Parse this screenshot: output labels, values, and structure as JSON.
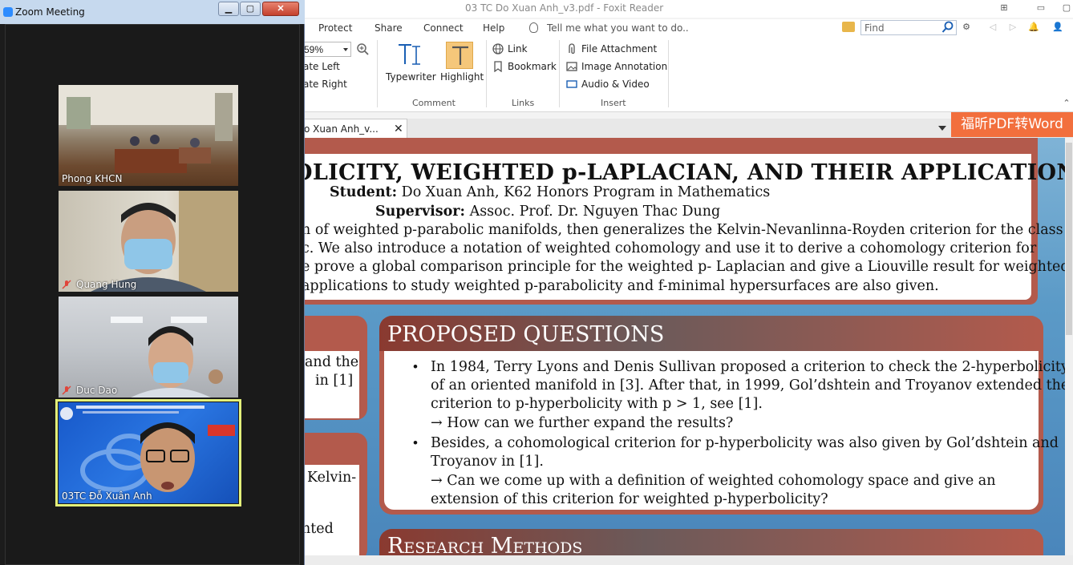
{
  "foxit": {
    "title": "03 TC Do Xuan Anh_v3.pdf - Foxit Reader",
    "menu": [
      "Protect",
      "Share",
      "Connect",
      "Help"
    ],
    "tellme_placeholder": "Tell me what you want to do..",
    "find_placeholder": "Find",
    "ribbon": {
      "zoom_value": "59%",
      "rotate_left": "ate Left",
      "rotate_right": "ate Right",
      "typewriter": "Typewriter",
      "highlight": "Highlight",
      "comment_group": "Comment",
      "link": "Link",
      "bookmark": "Bookmark",
      "links_group": "Links",
      "file_attachment": "File Attachment",
      "image_annotation": "Image Annotation",
      "audio_video": "Audio & Video",
      "insert_group": "Insert"
    },
    "tab_label": "o Xuan Anh_v...",
    "convert_button": "福昕PDF转Word"
  },
  "poster": {
    "title": "OLICITY, WEIGHTED p-LAPLACIAN, AND THEIR APPLICATIONS",
    "student_label": "Student:",
    "student_value": "Do Xuan Anh, K62 Honors Program in Mathematics",
    "supervisor_label": "Supervisor:",
    "supervisor_value": "Assoc. Prof. Dr. Nguyen Thac Dung",
    "abstract_lines": [
      "n of weighted p-parabolic manifolds, then generalizes the Kelvin-Nevanlinna-Royden criterion for the class",
      "c. We also introduce a notation of weighted cohomology and use it to derive a cohomology criterion for",
      "e prove a global comparison principle for the weighted p- Laplacian and give a Liouville result for weighted",
      "applications to study weighted p-parabolicity and f-minimal hypersurfaces are also given."
    ],
    "left_card_1_lines": [
      "and  the",
      "in   [1]"
    ],
    "left_card_2_lines": [
      "Kelvin-",
      "hted"
    ],
    "pq_title": "PROPOSED QUESTIONS",
    "pq_lines": [
      "In 1984, Terry Lyons and Denis Sullivan proposed a criterion to check the 2-hyperbolicity",
      "of an oriented manifold in [3]. After that, in 1999, Gol’dshtein and Troyanov extended the",
      "criterion to p-hyperbolicity with p > 1, see [1].",
      "→ How can we further expand the results?",
      "Besides, a cohomological criterion for p-hyperbolicity was also given by Gol’dshtein and",
      "Troyanov in [1].",
      "→ Can we come up with a definition of weighted cohomology space and give an",
      "extension of this criterion for weighted p-hyperbolicity?"
    ],
    "rm_title": "Research Methods"
  },
  "zoom": {
    "title": "Zoom Meeting",
    "participants": [
      {
        "name": "Phong KHCN",
        "muted": false
      },
      {
        "name": "Quang Hung",
        "muted": true
      },
      {
        "name": "Duc Dao",
        "muted": true
      },
      {
        "name": "03TC Đỗ Xuân Anh",
        "muted": false
      }
    ],
    "active_speaker_color": "#e3f07a"
  },
  "colors": {
    "poster_accent": "#b35a4c",
    "convert_orange": "#f26f3d",
    "zoom_titlebar": "#c6d9ee"
  }
}
